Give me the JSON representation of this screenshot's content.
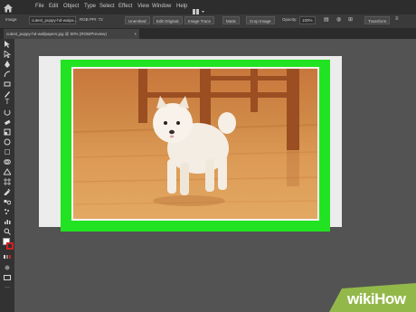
{
  "menu": {
    "items": [
      "File",
      "Edit",
      "Object",
      "Type",
      "Select",
      "Effect",
      "View",
      "Window",
      "Help"
    ]
  },
  "control_bar": {
    "image_label": "Image",
    "filename": "cutest_puppy-hd-walpa...",
    "color_info": "RGB PPI: 72",
    "unembed": "Unembed",
    "edit_original": "Edit Original",
    "image_trace": "Image Trace",
    "mask": "Mask",
    "crop_image": "Crop Image",
    "opacity_label": "Opacity:",
    "opacity_value": "100%",
    "transform": "Transform"
  },
  "document_tab": {
    "title": "cutest_puppy-hd-wallpapers.jpg @ 50% (RGB/Preview)",
    "close": "×"
  },
  "watermark": {
    "wiki": "wiki",
    "how": "How"
  },
  "colors": {
    "frame_green": "#22e322",
    "artboard": "#ececec",
    "workspace": "#535353",
    "wikihow_green": "#93b84a"
  }
}
